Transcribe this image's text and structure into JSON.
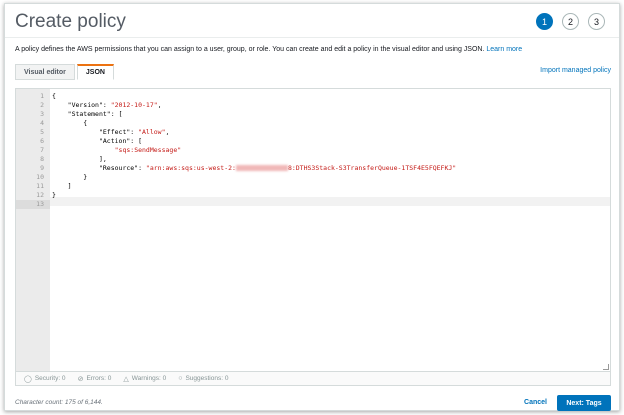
{
  "header": {
    "title": "Create policy",
    "steps": [
      "1",
      "2",
      "3"
    ]
  },
  "description": {
    "text": "A policy defines the AWS permissions that you can assign to a user, group, or role. You can create and edit a policy in the visual editor and using JSON.",
    "link": "Learn more"
  },
  "tabs": [
    {
      "label": "Visual editor"
    },
    {
      "label": "JSON"
    }
  ],
  "import_link": "Import managed policy",
  "editor": {
    "line_numbers": [
      "1",
      "2",
      "3",
      "4",
      "5",
      "6",
      "7",
      "8",
      "9",
      "10",
      "11",
      "12",
      "13"
    ],
    "lines": [
      {
        "text": "{"
      },
      {
        "key": "    \"Version\": ",
        "str": "\"2012-10-17\"",
        "post": ","
      },
      {
        "text": "    \"Statement\": ["
      },
      {
        "text": "        {"
      },
      {
        "key": "            \"Effect\": ",
        "str": "\"Allow\"",
        "post": ","
      },
      {
        "text": "            \"Action\": ["
      },
      {
        "key": "                ",
        "str": "\"sqs:SendMessage\"",
        "post": ""
      },
      {
        "text": "            ],"
      },
      {
        "key": "            \"Resource\": ",
        "str": "\"arn:aws:sqs:us-west-2:",
        "str2": "8:DTHS3Stack-S3TransferQueue-1TSF4E5FQEFKJ\"",
        "post": ""
      },
      {
        "text": "        }"
      },
      {
        "text": "    ]"
      },
      {
        "text": "}"
      },
      {
        "text": ""
      }
    ]
  },
  "status": {
    "security": "Security: 0",
    "errors": "Errors: 0",
    "warnings": "Warnings: 0",
    "suggestions": "Suggestions: 0"
  },
  "footer": {
    "char_count": "Character count: 175 of 6,144.",
    "cancel": "Cancel",
    "next": "Next: Tags"
  },
  "colors": {
    "accent": "#0073bb",
    "tab_highlight": "#ec7211",
    "string": "#c41a16"
  }
}
